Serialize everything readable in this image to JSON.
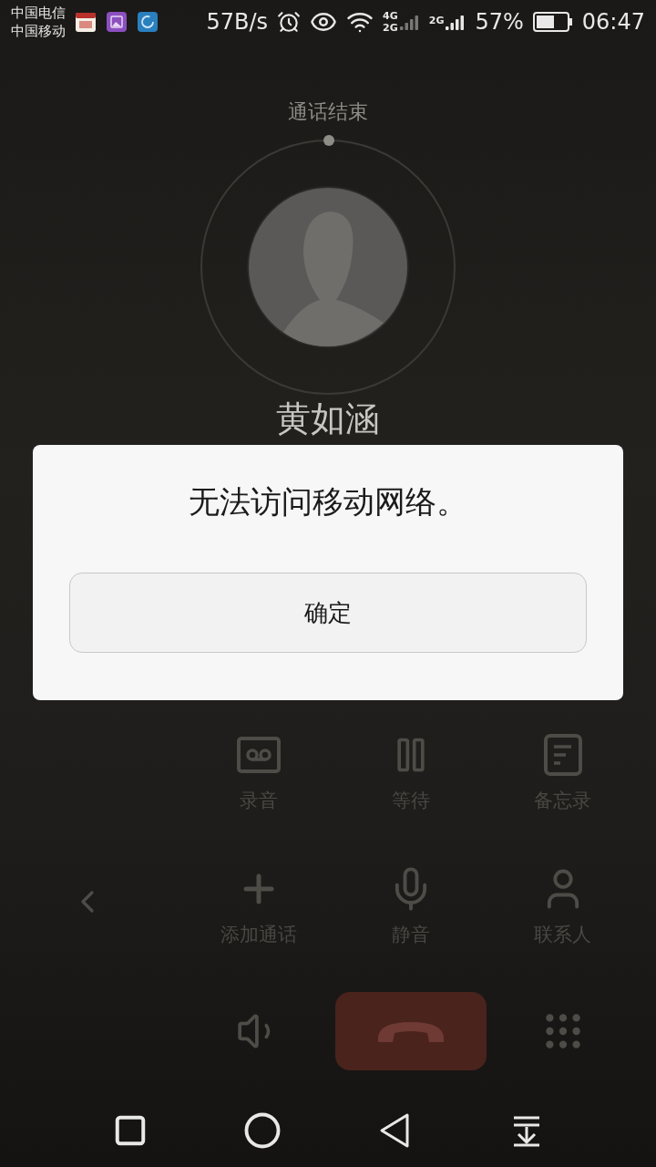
{
  "status_bar": {
    "carriers": [
      "中国电信",
      "中国移动"
    ],
    "speed": "57B/s",
    "sim1_networks": [
      "4G",
      "2G"
    ],
    "sim2_network": "2G",
    "battery": "57%",
    "time": "06:47"
  },
  "call": {
    "status": "通话结束",
    "name": "黄如涵"
  },
  "actions": [
    {
      "kind": "record",
      "label": "录音"
    },
    {
      "kind": "hold",
      "label": "等待"
    },
    {
      "kind": "memo",
      "label": "备忘录"
    },
    {
      "kind": "add",
      "label": "添加通话"
    },
    {
      "kind": "mute",
      "label": "静音"
    },
    {
      "kind": "contacts",
      "label": "联系人"
    }
  ],
  "dialog": {
    "message": "无法访问移动网络。",
    "button": "确定"
  }
}
